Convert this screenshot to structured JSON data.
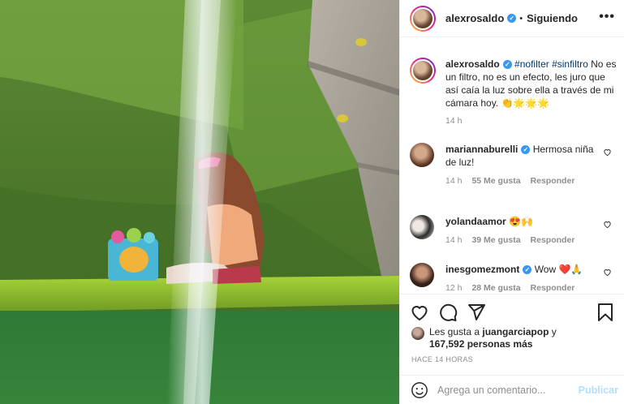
{
  "post_author": {
    "username": "alexrosaldo",
    "verified": true,
    "separator": "•",
    "follow_status": "Siguiendo",
    "more_icon": "more-horizontal-icon"
  },
  "caption": {
    "username": "alexrosaldo",
    "hashtags": "#nofilter #sinfiltro",
    "text": "No es un filtro, no es un efecto, les juro que así caía la luz sobre ella a través de mi cámara hoy. 👏🌟🌟🌟",
    "time": "14 h"
  },
  "comments": [
    {
      "username": "mariannaburelli",
      "text": "Hermosa niña de luz!",
      "time": "14 h",
      "likes": "55 Me gusta",
      "reply": "Responder"
    },
    {
      "username": "yolandaamor",
      "text": "😍🙌",
      "time": "14 h",
      "likes": "39 Me gusta",
      "reply": "Responder"
    },
    {
      "username": "inesgomezmont",
      "text": "Wow ❤️🙏",
      "time": "12 h",
      "likes": "28 Me gusta",
      "reply": "Responder"
    }
  ],
  "actions": {
    "like_icon": "heart-icon",
    "comment_icon": "comment-icon",
    "share_icon": "share-icon",
    "save_icon": "bookmark-icon"
  },
  "likes": {
    "prefix": "Les gusta a",
    "user": "juangarciapop",
    "joiner": "y",
    "count": "167,592 personas más"
  },
  "posted_ago": "HACE 14 HORAS",
  "add_comment": {
    "placeholder": "Agrega un comentario...",
    "publish": "Publicar",
    "emoji_icon": "emoji-icon"
  },
  "colors": {
    "verified": "#3897f0",
    "link": "#00376b",
    "muted": "#8e8e8e",
    "publish_disabled": "#b2dffc"
  }
}
